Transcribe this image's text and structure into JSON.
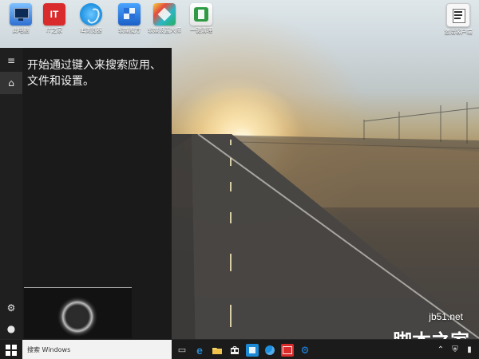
{
  "desktop": {
    "icons": [
      {
        "name": "this-pc",
        "label": "此电脑",
        "icon": "computer-icon",
        "color": "#3a7bd5"
      },
      {
        "name": "ithome",
        "label": "IT之家",
        "icon": "ithome-icon",
        "color": "#d92b2b"
      },
      {
        "name": "browser",
        "label": "IE浏览器",
        "icon": "browser-icon",
        "color": "#1b8fe0"
      },
      {
        "name": "app-store",
        "label": "软媒魔方",
        "icon": "cube-icon",
        "color": "#2a6fd6"
      },
      {
        "name": "photo",
        "label": "软媒设置大师",
        "icon": "photo-icon",
        "color": "#2bb7c8"
      },
      {
        "name": "one-key",
        "label": "一键清理",
        "icon": "clean-icon",
        "color": "#2f9a43"
      },
      {
        "name": "doc",
        "label": "激活客户端",
        "icon": "doc-icon",
        "color": "#e8f0f6"
      }
    ]
  },
  "start": {
    "prompt": "开始通过键入来搜索应用、\n文件和设置。",
    "rail": {
      "hamburger": "menu-icon",
      "home": "home-icon",
      "settings": "gear-icon",
      "user": "user-icon"
    }
  },
  "taskbar": {
    "search_placeholder": "搜索 Windows",
    "start_icon": "windows-logo-icon",
    "task_icons": [
      {
        "name": "task-view",
        "icon": "task-view-icon",
        "color": "#d7d7d7"
      },
      {
        "name": "edge",
        "icon": "edge-icon",
        "color": "#2a8bd6"
      },
      {
        "name": "explorer",
        "icon": "folder-icon",
        "color": "#f0c14b"
      },
      {
        "name": "store",
        "icon": "store-icon",
        "color": "#f2f2f2"
      },
      {
        "name": "app-blue",
        "icon": "app-icon",
        "color": "#1d88d6"
      },
      {
        "name": "app-circle",
        "icon": "circle-app-icon",
        "color": "#1b8fe0"
      },
      {
        "name": "app-red",
        "icon": "red-app-icon",
        "color": "#d92b2b"
      },
      {
        "name": "app-cog",
        "icon": "settings-app-icon",
        "color": "#1e88e5"
      }
    ],
    "tray": [
      {
        "name": "tray-up",
        "icon": "chevron-up-icon"
      },
      {
        "name": "tray-shield",
        "icon": "shield-icon"
      },
      {
        "name": "tray-network",
        "icon": "network-icon"
      }
    ]
  },
  "watermark": {
    "site": "jb51.net",
    "cn": "脚本之家"
  }
}
